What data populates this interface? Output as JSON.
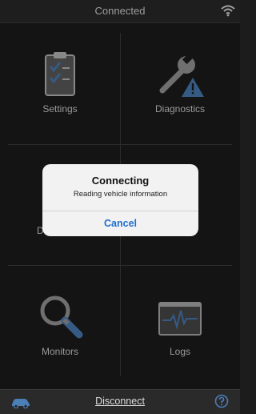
{
  "status_bar": {
    "title": "Connected",
    "wifi_icon": "wifi-icon"
  },
  "tiles": [
    {
      "label": "Settings",
      "icon": "clipboard-checklist-icon"
    },
    {
      "label": "Diagnostics",
      "icon": "wrench-warning-icon"
    },
    {
      "label": "D",
      "icon": "hidden-tile-icon"
    },
    {
      "label": "",
      "icon": "hidden-tile-icon"
    },
    {
      "label": "Monitors",
      "icon": "magnifier-icon"
    },
    {
      "label": "Logs",
      "icon": "waveform-monitor-icon"
    }
  ],
  "alert": {
    "title": "Connecting",
    "message": "Reading vehicle information",
    "button": "Cancel"
  },
  "bottom_bar": {
    "disconnect_label": "Disconnect",
    "car_icon": "car-icon",
    "help_icon": "help-icon"
  },
  "colors": {
    "accent": "#4a7fb8",
    "warning": "#4a7fb8",
    "background": "#1c1c1c",
    "alert_button": "#1f6fd1"
  }
}
